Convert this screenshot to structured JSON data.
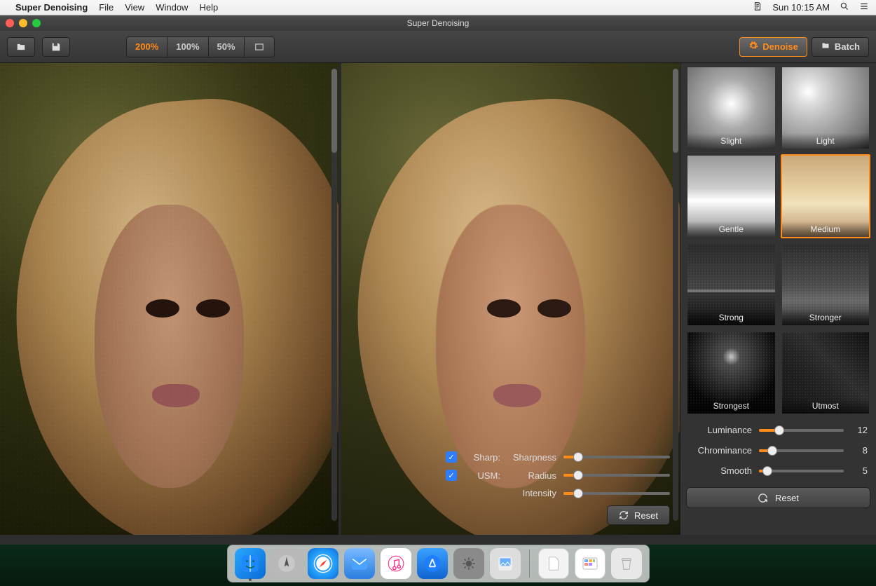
{
  "menubar": {
    "app_name": "Super Denoising",
    "items": [
      "File",
      "View",
      "Window",
      "Help"
    ],
    "clock": "Sun 10:15 AM"
  },
  "window": {
    "title": "Super Denoising"
  },
  "toolbar": {
    "zoom": {
      "levels": [
        "200%",
        "100%",
        "50%"
      ],
      "active_index": 0
    },
    "modes": {
      "denoise": "Denoise",
      "batch": "Batch",
      "active": "denoise"
    }
  },
  "overlay": {
    "rows": [
      {
        "checkbox": true,
        "checked": true,
        "label": "Sharp:",
        "param": "Sharpness",
        "pct": 14
      },
      {
        "checkbox": true,
        "checked": true,
        "label": "USM:",
        "param": "Radius",
        "pct": 14
      },
      {
        "checkbox": false,
        "label": "",
        "param": "Intensity",
        "pct": 14
      }
    ],
    "reset": "Reset"
  },
  "presets": {
    "items": [
      {
        "label": "Slight",
        "key": "slight"
      },
      {
        "label": "Light",
        "key": "light"
      },
      {
        "label": "Gentle",
        "key": "gentle"
      },
      {
        "label": "Medium",
        "key": "medium"
      },
      {
        "label": "Strong",
        "key": "strong"
      },
      {
        "label": "Stronger",
        "key": "stronger"
      },
      {
        "label": "Strongest",
        "key": "strongest"
      },
      {
        "label": "Utmost",
        "key": "utmost"
      }
    ],
    "selected_index": 3
  },
  "sliders": {
    "items": [
      {
        "name": "Luminance",
        "value": 12,
        "min": 0,
        "max": 50
      },
      {
        "name": "Chrominance",
        "value": 8,
        "min": 0,
        "max": 50
      },
      {
        "name": "Smooth",
        "value": 5,
        "min": 0,
        "max": 50
      }
    ],
    "reset": "Reset"
  },
  "dock": {
    "apps": [
      "finder",
      "launchpad",
      "safari",
      "mail",
      "itunes",
      "appstore",
      "preferences",
      "preview"
    ],
    "right": [
      "document",
      "files",
      "trash"
    ],
    "running": [
      "finder"
    ]
  }
}
